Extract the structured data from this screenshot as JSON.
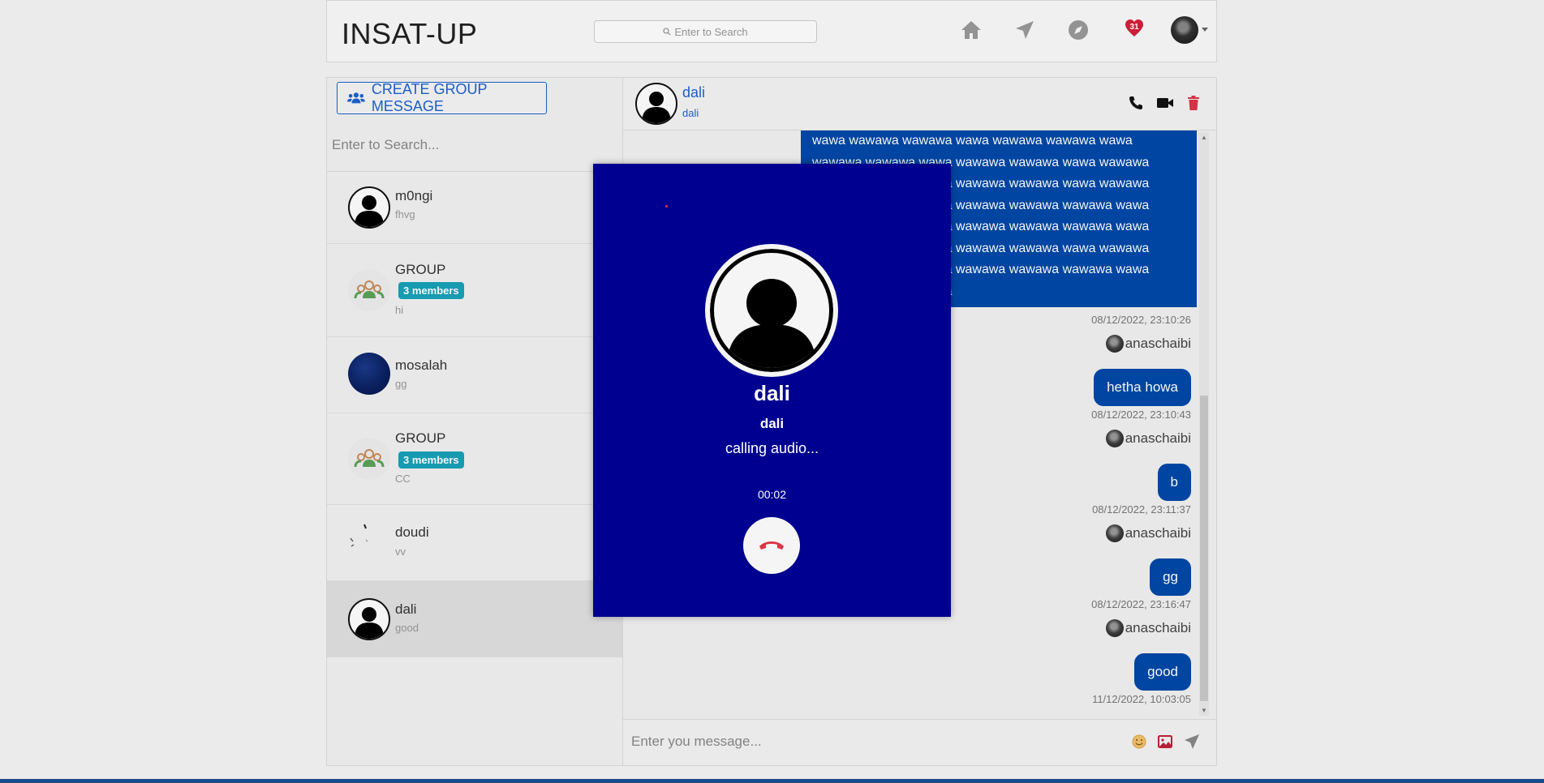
{
  "header": {
    "brand": "INSAT-UP",
    "search_placeholder": "Enter to Search",
    "notification_count": "31",
    "icons": [
      "home-icon",
      "send-icon",
      "compass-icon",
      "heart-icon",
      "avatar"
    ]
  },
  "sidebar": {
    "create_group_label": "CREATE GROUP MESSAGE",
    "search_placeholder": "Enter to Search...",
    "conversations": [
      {
        "name": "m0ngi",
        "last": "fhvg"
      },
      {
        "name": "GROUP",
        "members": "3 members",
        "last": "hi"
      },
      {
        "name": "mosalah",
        "last": "gg"
      },
      {
        "name": "GROUP",
        "members": "3 members",
        "last": "CC"
      },
      {
        "name": "doudi",
        "last": "vv"
      },
      {
        "name": "dali",
        "last": "good"
      }
    ]
  },
  "chat": {
    "name": "dali",
    "sub": "dali",
    "big_message_lines": [
      "wawa wawawa wawawa wawa wawawa wawawa wawa",
      "wawawa wawawa wawa wawawa wawawa wawa wawawa",
      "wawawa wawawa wawa wawawa wawawa wawa wawawa",
      "wawawa wawawa wawa wawawa wawawa wawawa wawa",
      "wawawa wawawa wawa wawawa wawawa wawawa wawa",
      "wawawa wawawa wawa wawawa wawawa wawa wawawa",
      "wawawa wawawa wawa wawawa wawawa wawawa wawa",
      "wawawa wawawa wawa"
    ],
    "messages": [
      {
        "time": "08/12/2022, 23:10:26",
        "sender": "anaschaibi",
        "text": "hetha howa"
      },
      {
        "time": "08/12/2022, 23:10:43",
        "sender": "anaschaibi",
        "text": "b"
      },
      {
        "time": "08/12/2022, 23:11:37",
        "sender": "anaschaibi",
        "text": "gg"
      },
      {
        "time": "08/12/2022, 23:16:47",
        "sender": "anaschaibi",
        "text": "good"
      },
      {
        "time": "11/12/2022, 10:03:05"
      }
    ],
    "composer_placeholder": "Enter you message..."
  },
  "call": {
    "name": "dali",
    "sub": "dali",
    "status": "calling audio...",
    "timer": "00:02"
  },
  "colors": {
    "accent": "#1e62d0",
    "bubble": "#0048a8",
    "call_bg": "#000090",
    "danger": "#dc3545",
    "badge": "#17a2b8"
  }
}
